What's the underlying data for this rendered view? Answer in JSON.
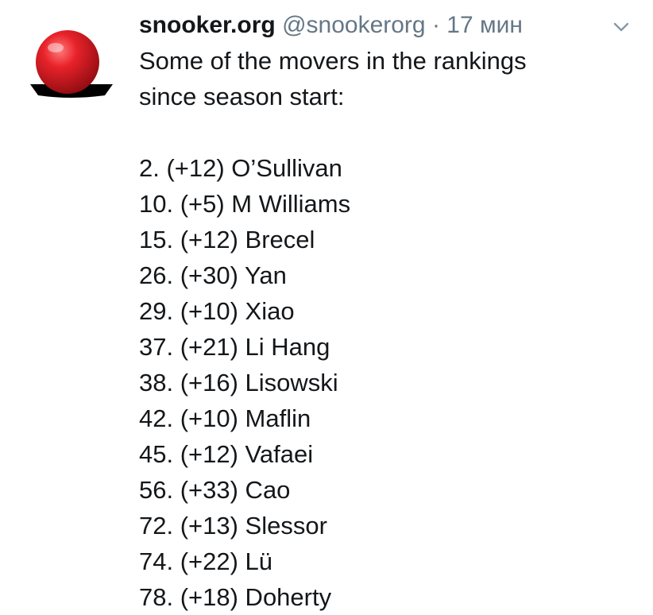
{
  "tweet": {
    "display_name": "snooker.org",
    "handle": "@snookerorg",
    "separator": "·",
    "time": "17 мин",
    "avatar_icon": "snooker-ball-icon",
    "menu_icon": "chevron-down-icon",
    "intro_lines": [
      "Some of the movers in the rankings",
      "since season start:"
    ],
    "rankings": [
      "2. (+12) O’Sullivan",
      "10. (+5) M Williams",
      "15. (+12) Brecel",
      "26. (+30) Yan",
      "29. (+10) Xiao",
      "37. (+21) Li Hang",
      "38. (+16) Lisowski",
      "42. (+10) Maflin",
      "45. (+12) Vafaei",
      "56. (+33) Cao",
      "72. (+13) Slessor",
      "74. (+22) Lü",
      "78. (+18) Doherty"
    ]
  },
  "colors": {
    "ball_red": "#d8141c",
    "shadow": "#000000",
    "text": "#14171a",
    "muted": "#657786"
  }
}
